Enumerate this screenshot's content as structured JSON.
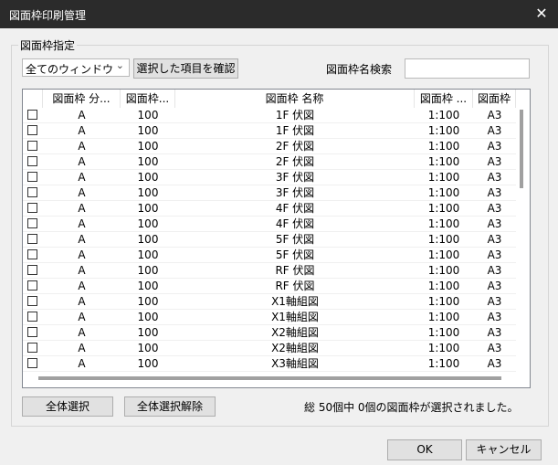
{
  "window": {
    "title": "図面枠印刷管理",
    "close_glyph": "✕"
  },
  "group": {
    "label": "図面枠指定"
  },
  "toolbar": {
    "window_select_value": "全てのウィンドウ",
    "confirm_selected_label": "選択した項目を確認",
    "search_label": "図面枠名検索",
    "search_value": ""
  },
  "table": {
    "columns": [
      "",
      "図面枠 分...",
      "図面枠...",
      "図面枠 名称",
      "図面枠 ...",
      "図面枠"
    ],
    "rows": [
      {
        "checked": false,
        "cells": [
          "A",
          "100",
          "1F 伏図",
          "1:100",
          "A3"
        ]
      },
      {
        "checked": false,
        "cells": [
          "A",
          "100",
          "1F 伏図",
          "1:100",
          "A3"
        ]
      },
      {
        "checked": false,
        "cells": [
          "A",
          "100",
          "2F 伏図",
          "1:100",
          "A3"
        ]
      },
      {
        "checked": false,
        "cells": [
          "A",
          "100",
          "2F 伏図",
          "1:100",
          "A3"
        ]
      },
      {
        "checked": false,
        "cells": [
          "A",
          "100",
          "3F 伏図",
          "1:100",
          "A3"
        ]
      },
      {
        "checked": false,
        "cells": [
          "A",
          "100",
          "3F 伏図",
          "1:100",
          "A3"
        ]
      },
      {
        "checked": false,
        "cells": [
          "A",
          "100",
          "4F 伏図",
          "1:100",
          "A3"
        ]
      },
      {
        "checked": false,
        "cells": [
          "A",
          "100",
          "4F 伏図",
          "1:100",
          "A3"
        ]
      },
      {
        "checked": false,
        "cells": [
          "A",
          "100",
          "5F 伏図",
          "1:100",
          "A3"
        ]
      },
      {
        "checked": false,
        "cells": [
          "A",
          "100",
          "5F 伏図",
          "1:100",
          "A3"
        ]
      },
      {
        "checked": false,
        "cells": [
          "A",
          "100",
          "RF 伏図",
          "1:100",
          "A3"
        ]
      },
      {
        "checked": false,
        "cells": [
          "A",
          "100",
          "RF 伏図",
          "1:100",
          "A3"
        ]
      },
      {
        "checked": false,
        "cells": [
          "A",
          "100",
          "X1軸組図",
          "1:100",
          "A3"
        ]
      },
      {
        "checked": false,
        "cells": [
          "A",
          "100",
          "X1軸組図",
          "1:100",
          "A3"
        ]
      },
      {
        "checked": false,
        "cells": [
          "A",
          "100",
          "X2軸組図",
          "1:100",
          "A3"
        ]
      },
      {
        "checked": false,
        "cells": [
          "A",
          "100",
          "X2軸組図",
          "1:100",
          "A3"
        ]
      },
      {
        "checked": false,
        "cells": [
          "A",
          "100",
          "X3軸組図",
          "1:100",
          "A3"
        ]
      }
    ]
  },
  "footer": {
    "select_all_label": "全体選択",
    "deselect_all_label": "全体選択解除",
    "status_text": "総 50個中 0個の図面枠が選択されました。"
  },
  "dialog": {
    "ok_label": "OK",
    "cancel_label": "キャンセル"
  }
}
